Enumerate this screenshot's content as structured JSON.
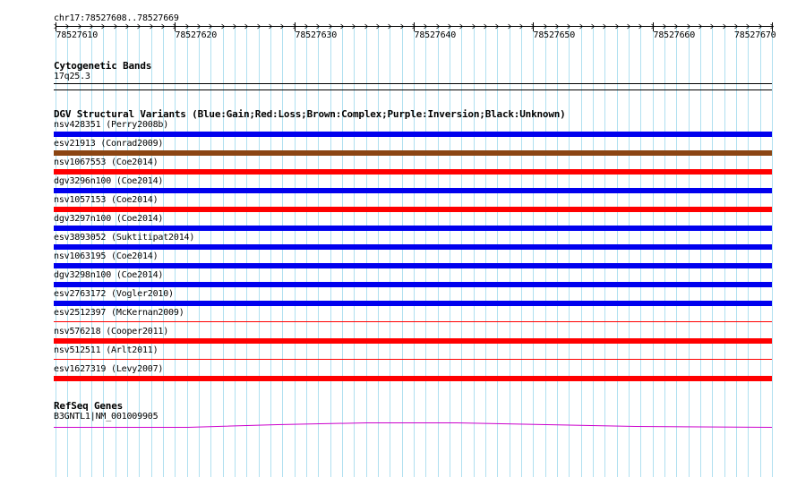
{
  "ruler": {
    "location": "chr17:78527608..78527669",
    "ticks": [
      "78527610",
      "78527620",
      "78527630",
      "78527640",
      "78527650",
      "78527660",
      "78527670"
    ]
  },
  "cytoband": {
    "title": "Cytogenetic Bands",
    "band": "17q25.3"
  },
  "dgv": {
    "title": "DGV Structural Variants (Blue:Gain;Red:Loss;Brown:Complex;Purple:Inversion;Black:Unknown)",
    "colors": {
      "gain": "#0000ee",
      "loss": "#ff0000",
      "complex": "#8b4513",
      "inversion": "#800080",
      "unknown": "#000000"
    },
    "variants": [
      {
        "label": "nsv428351 (Perry2008b)",
        "type": "gain",
        "style": "thick"
      },
      {
        "label": "esv21913 (Conrad2009)",
        "type": "complex",
        "style": "thick"
      },
      {
        "label": "nsv1067553 (Coe2014)",
        "type": "loss",
        "style": "thick"
      },
      {
        "label": "dgv3296n100 (Coe2014)",
        "type": "gain",
        "style": "thick"
      },
      {
        "label": "nsv1057153 (Coe2014)",
        "type": "loss",
        "style": "thick"
      },
      {
        "label": "dgv3297n100 (Coe2014)",
        "type": "gain",
        "style": "thick"
      },
      {
        "label": "esv3893052 (Suktitipat2014)",
        "type": "gain",
        "style": "thick"
      },
      {
        "label": "nsv1063195 (Coe2014)",
        "type": "gain",
        "style": "thick"
      },
      {
        "label": "dgv3298n100 (Coe2014)",
        "type": "gain",
        "style": "thick"
      },
      {
        "label": "esv2763172 (Vogler2010)",
        "type": "gain",
        "style": "thick"
      },
      {
        "label": "esv2512397 (McKernan2009)",
        "type": "loss",
        "style": "thin"
      },
      {
        "label": "nsv576218 (Cooper2011)",
        "type": "loss",
        "style": "thick"
      },
      {
        "label": "nsv512511 (Arlt2011)",
        "type": "loss",
        "style": "thin"
      },
      {
        "label": "esv1627319 (Levy2007)",
        "type": "loss",
        "style": "thick"
      }
    ]
  },
  "refseq": {
    "title": "RefSeq Genes",
    "gene": "B3GNTL1|NM_001009905",
    "color": "#cc00cc"
  },
  "grid_color": "#b0e0f0"
}
